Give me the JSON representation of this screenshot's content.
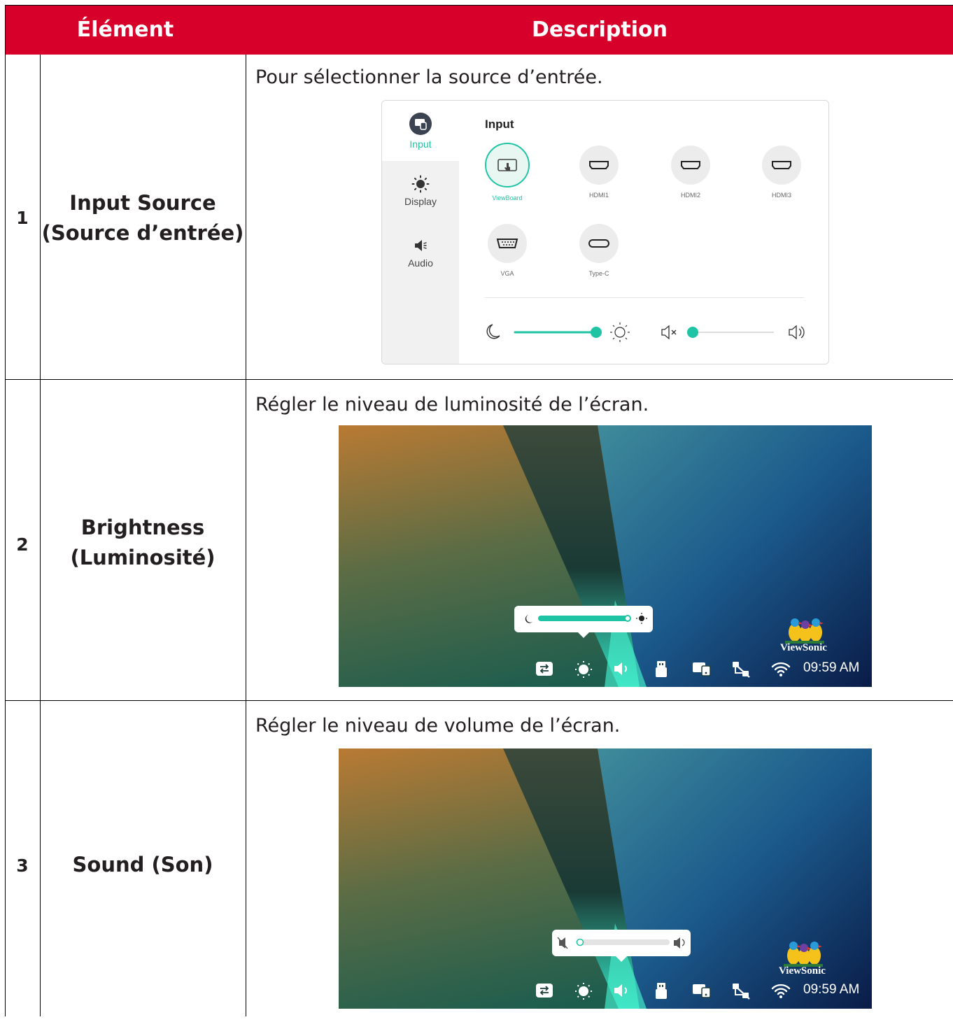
{
  "header": {
    "col1": "Élément",
    "col2": "Description"
  },
  "rows": [
    {
      "num": "1",
      "name_line1": "Input Source",
      "name_line2": "(Source d’entrée)",
      "desc": "Pour sélectionner la source d’entrée."
    },
    {
      "num": "2",
      "name_line1": "Brightness",
      "name_line2": "(Luminosité)",
      "desc": "Régler le niveau de luminosité de l’écran."
    },
    {
      "num": "3",
      "name_line1": "Sound (Son)",
      "name_line2": "",
      "desc": "Régler le niveau de volume de l’écran."
    }
  ],
  "panel": {
    "sidebar": [
      {
        "label": "Input",
        "icon": "input-icon"
      },
      {
        "label": "Display",
        "icon": "brightness-icon"
      },
      {
        "label": "Audio",
        "icon": "speaker-icon"
      }
    ],
    "title": "Input",
    "sources": [
      {
        "label": "ViewBoard",
        "icon": "touch-screen-icon"
      },
      {
        "label": "HDMI1",
        "icon": "hdmi-port-icon"
      },
      {
        "label": "HDMI2",
        "icon": "hdmi-port-icon"
      },
      {
        "label": "HDMI3",
        "icon": "hdmi-port-icon"
      },
      {
        "label": "VGA",
        "icon": "vga-port-icon"
      },
      {
        "label": "Type-C",
        "icon": "usb-c-port-icon"
      }
    ],
    "selected_source": "ViewBoard",
    "brightness_level": 1.0,
    "volume_level": 0.0,
    "accent_color": "#1fc4a4"
  },
  "screens": {
    "clock": "09:59 AM",
    "brand": "ViewSonic",
    "brightness_popup_level": 1.0,
    "volume_popup_level": 0.0
  },
  "colors": {
    "header_bg": "#d6002a",
    "accent": "#1fc4a4"
  }
}
